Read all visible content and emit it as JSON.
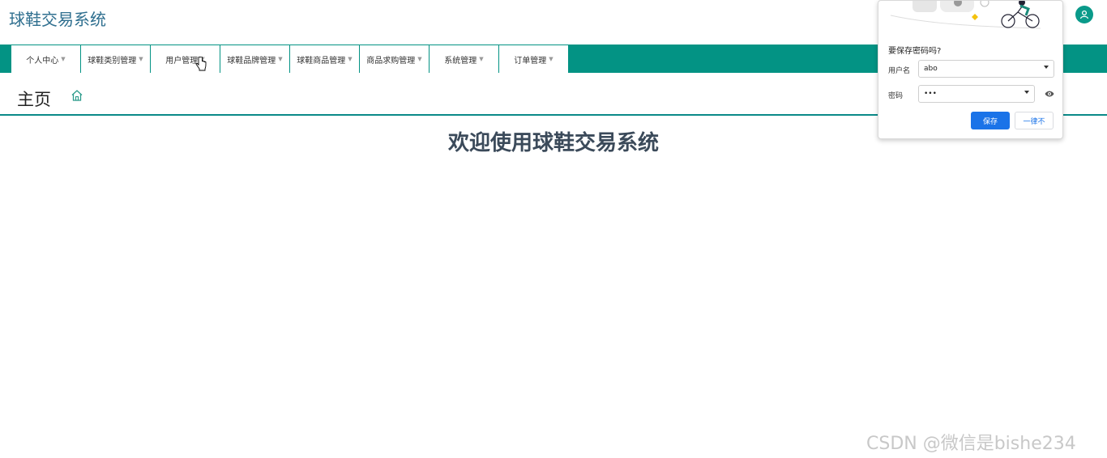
{
  "app": {
    "title": "球鞋交易系统"
  },
  "nav": {
    "items": [
      {
        "label": "个人中心"
      },
      {
        "label": "球鞋类别管理"
      },
      {
        "label": "用户管理"
      },
      {
        "label": "球鞋品牌管理"
      },
      {
        "label": "球鞋商品管理"
      },
      {
        "label": "商品求购管理"
      },
      {
        "label": "系统管理"
      },
      {
        "label": "订单管理"
      }
    ]
  },
  "breadcrumb": {
    "title": "主页",
    "icon": "home-icon"
  },
  "main": {
    "welcome": "欢迎使用球鞋交易系统"
  },
  "password_popup": {
    "heading": "要保存密码吗?",
    "username_label": "用户名",
    "username_value": "abo",
    "password_label": "密码",
    "password_value": "•••",
    "save_label": "保存",
    "never_label": "一律不"
  },
  "watermark": "CSDN @微信是bishe234",
  "colors": {
    "accent": "#039384",
    "title": "#2f6f8f",
    "save_button": "#1a73e8"
  }
}
